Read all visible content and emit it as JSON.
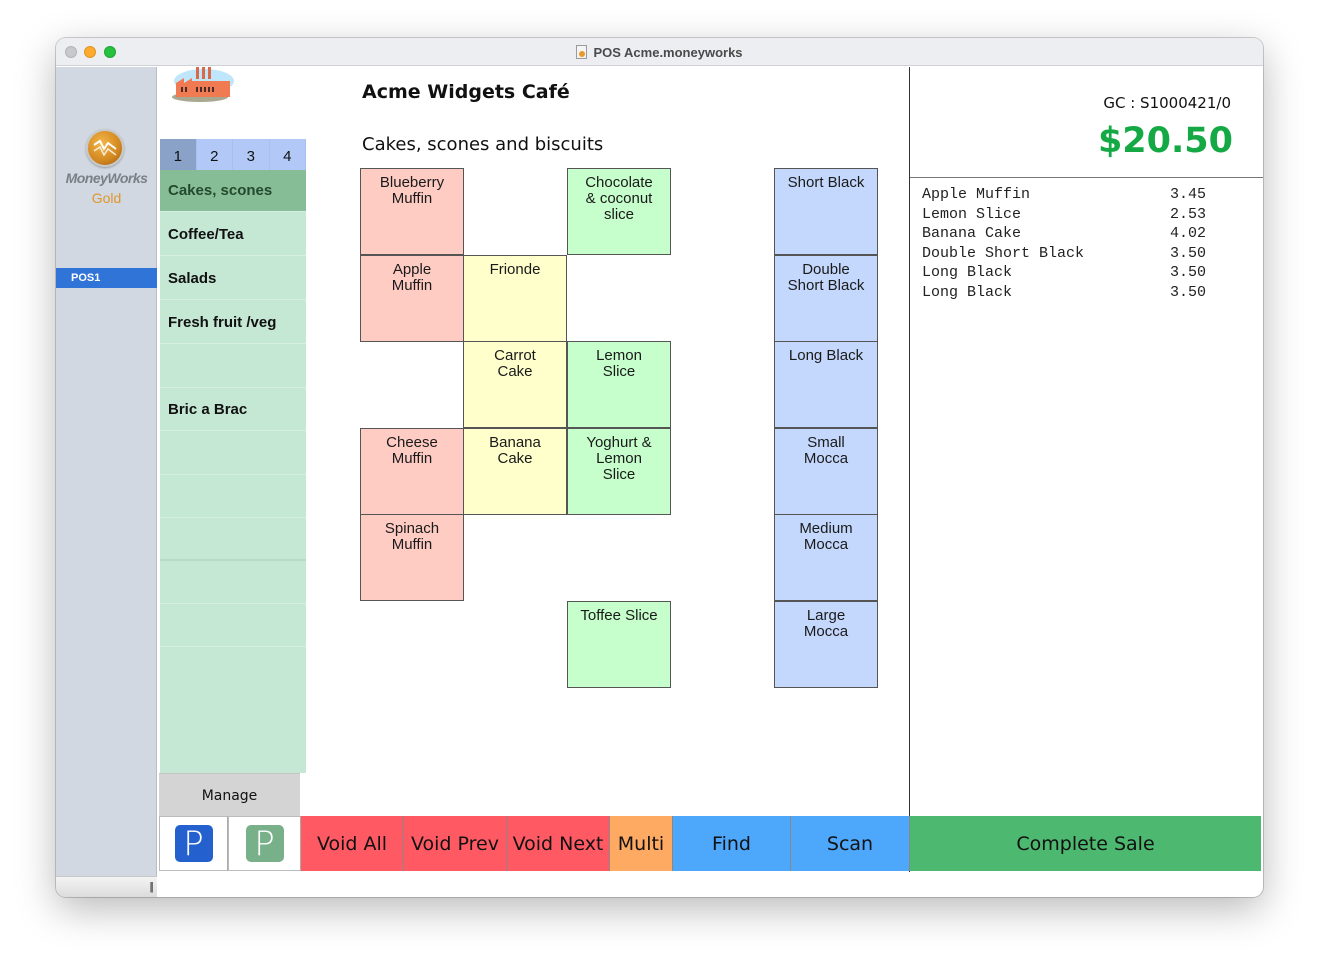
{
  "window": {
    "title": "POS Acme.moneyworks"
  },
  "sidebar": {
    "brand_name": "MoneyWorks",
    "brand_edition": "Gold",
    "items": [
      {
        "label": "POS1",
        "selected": true
      }
    ]
  },
  "header": {
    "company": "Acme Widgets Café",
    "category_title": "Cakes, scones and biscuits"
  },
  "pages": {
    "tabs": [
      {
        "label": "1",
        "active": true
      },
      {
        "label": "2",
        "active": false
      },
      {
        "label": "3",
        "active": false
      },
      {
        "label": "4",
        "active": false
      }
    ]
  },
  "categories": [
    {
      "label": "Cakes, scones",
      "active": true
    },
    {
      "label": "Coffee/Tea",
      "active": false
    },
    {
      "label": "Salads",
      "active": false
    },
    {
      "label": "Fresh fruit /veg",
      "active": false
    },
    {
      "label": "",
      "active": false
    },
    {
      "label": "Bric a Brac",
      "active": false
    }
  ],
  "products": [
    {
      "label": "Blueberry\nMuffin",
      "color": "#ffccc4"
    },
    {
      "label": "Chocolate\n& coconut\nslice",
      "color": "#c6ffcc"
    },
    {
      "label": "Apple\nMuffin",
      "color": "#ffccc4"
    },
    {
      "label": "Frionde",
      "color": "#ffffcc"
    },
    {
      "label": "Carrot\nCake",
      "color": "#ffffcc"
    },
    {
      "label": "Lemon\nSlice",
      "color": "#c6ffcc"
    },
    {
      "label": "Cheese\nMuffin",
      "color": "#ffccc4"
    },
    {
      "label": "Banana\nCake",
      "color": "#ffffcc"
    },
    {
      "label": "Yoghurt &\nLemon\nSlice",
      "color": "#c6ffcc"
    },
    {
      "label": "Spinach\nMuffin",
      "color": "#ffccc4"
    },
    {
      "label": "Toffee Slice",
      "color": "#c6ffcc"
    },
    {
      "label": "Short Black",
      "color": "#c4d8fd"
    },
    {
      "label": "Double\nShort Black",
      "color": "#c4d8fd"
    },
    {
      "label": "Long Black",
      "color": "#c4d8fd"
    },
    {
      "label": "Small\nMocca",
      "color": "#c4d8fd"
    },
    {
      "label": "Medium\nMocca",
      "color": "#c4d8fd"
    },
    {
      "label": "Large\nMocca",
      "color": "#c4d8fd"
    }
  ],
  "sale": {
    "reference": "GC : S1000421/0",
    "total": "$20.50",
    "total_color": "#14a944",
    "lines": [
      {
        "item": "Apple Muffin",
        "price": "3.45"
      },
      {
        "item": "Lemon Slice",
        "price": "2.53"
      },
      {
        "item": "Banana Cake",
        "price": "4.02"
      },
      {
        "item": "Double Short Black",
        "price": "3.50"
      },
      {
        "item": "Long Black",
        "price": "3.50"
      },
      {
        "item": "Long Black",
        "price": "3.50"
      }
    ]
  },
  "actions": {
    "manage": "Manage",
    "park_blue": "P",
    "park_green": "P",
    "void_all": "Void All",
    "void_prev": "Void Prev",
    "void_next": "Void Next",
    "multi": "Multi",
    "find": "Find",
    "scan": "Scan",
    "complete_sale": "Complete Sale"
  }
}
